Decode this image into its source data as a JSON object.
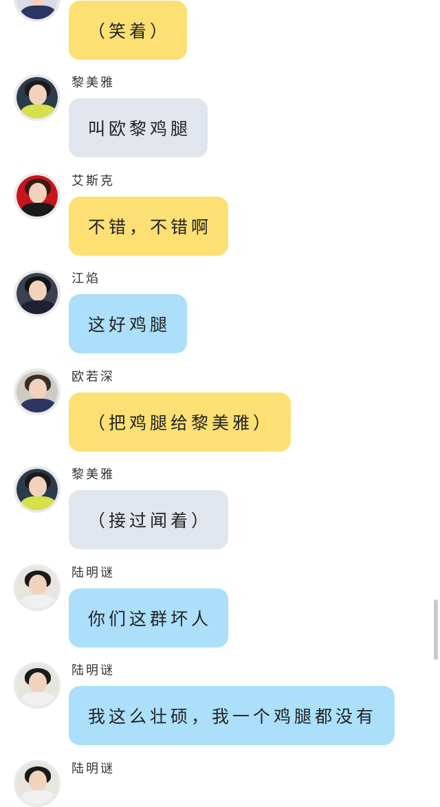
{
  "messages": [
    {
      "sender": "",
      "text": "（笑着）",
      "bubble_color": "#fde074",
      "avatar": "schoolboy-avatar"
    },
    {
      "sender": "黎美雅",
      "text": "叫欧黎鸡腿",
      "bubble_color": "#e1e5ee",
      "avatar": "girl-peace-sign-avatar"
    },
    {
      "sender": "艾斯克",
      "text": "不错，不错啊",
      "bubble_color": "#fde074",
      "avatar": "red-background-avatar"
    },
    {
      "sender": "江焰",
      "text": "这好鸡腿",
      "bubble_color": "#abdffa",
      "avatar": "dark-jacket-avatar"
    },
    {
      "sender": "欧若深",
      "text": "（把鸡腿给黎美雅）",
      "bubble_color": "#fde074",
      "avatar": "schoolboy-avatar"
    },
    {
      "sender": "黎美雅",
      "text": "（接过闻着）",
      "bubble_color": "#e1e5ee",
      "avatar": "girl-peace-sign-avatar"
    },
    {
      "sender": "陆明谜",
      "text": "你们这群坏人",
      "bubble_color": "#abdffa",
      "avatar": "glasses-boy-avatar"
    },
    {
      "sender": "陆明谜",
      "text": "我这么壮硕，我一个鸡腿都没有",
      "bubble_color": "#abdffa",
      "avatar": "glasses-boy-avatar"
    },
    {
      "sender": "陆明谜",
      "text": "",
      "bubble_color": "",
      "avatar": "glasses-boy-avatar"
    }
  ]
}
